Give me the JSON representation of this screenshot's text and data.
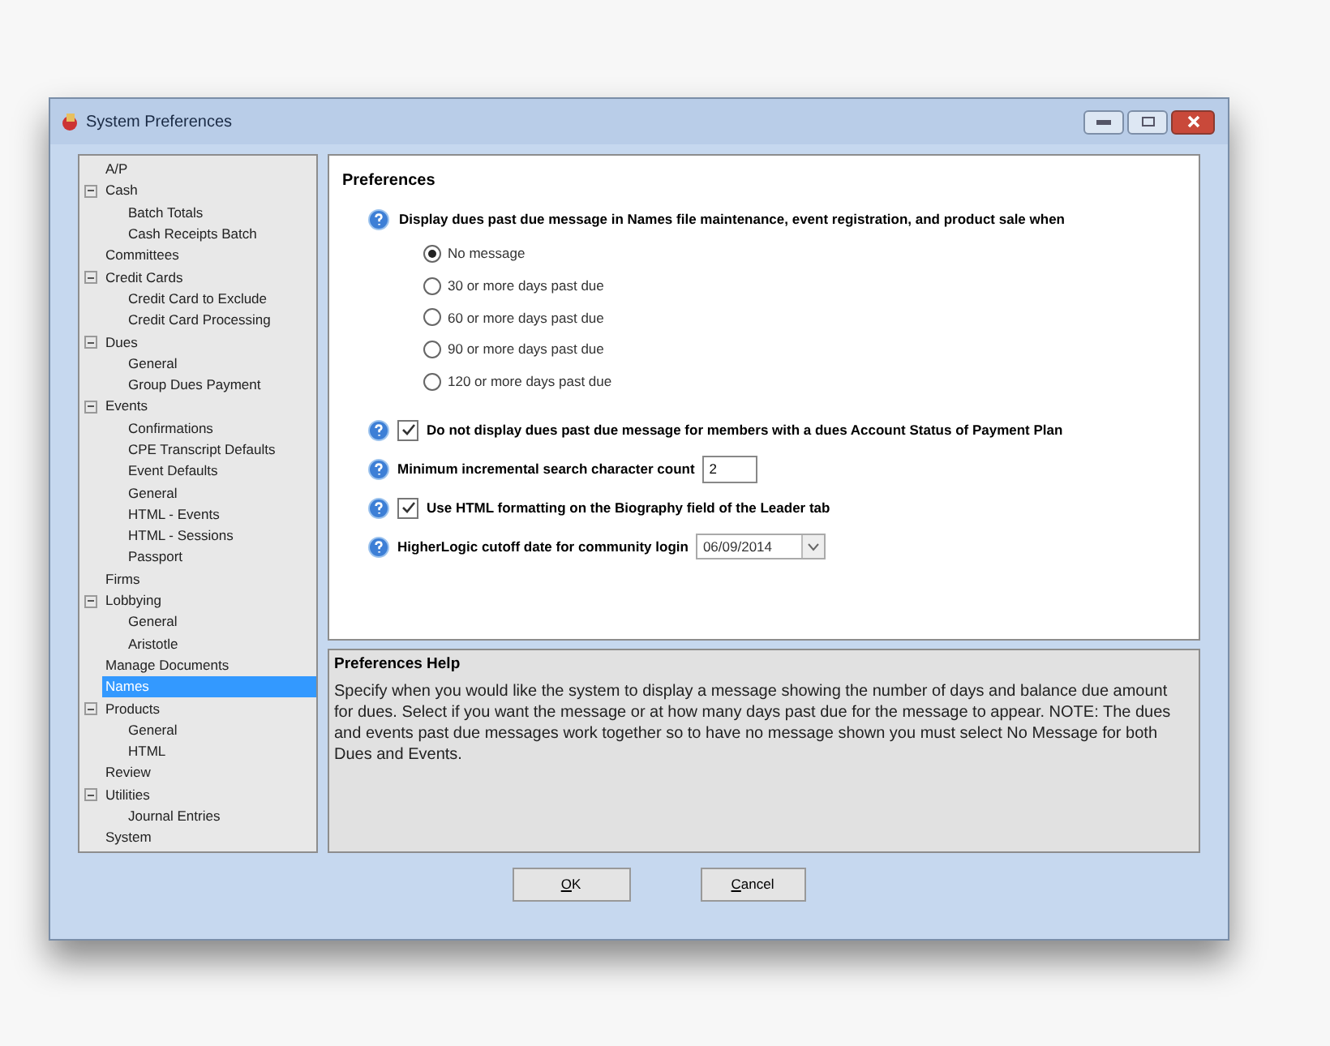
{
  "window": {
    "title": "System Preferences"
  },
  "tree": [
    {
      "label": "A/P",
      "selected": false
    },
    {
      "label": "Cash",
      "selected": false,
      "expanded": true,
      "children": [
        {
          "label": "Batch Totals",
          "selected": false
        },
        {
          "label": "Cash Receipts Batch",
          "selected": false
        }
      ]
    },
    {
      "label": "Committees",
      "selected": false
    },
    {
      "label": "Credit Cards",
      "selected": false,
      "expanded": true,
      "children": [
        {
          "label": "Credit Card to Exclude",
          "selected": false
        },
        {
          "label": "Credit Card Processing",
          "selected": false
        }
      ]
    },
    {
      "label": "Dues",
      "selected": false,
      "expanded": true,
      "children": [
        {
          "label": "General",
          "selected": false
        },
        {
          "label": "Group Dues Payment",
          "selected": false
        }
      ]
    },
    {
      "label": "Events",
      "selected": false,
      "expanded": true,
      "children": [
        {
          "label": "Confirmations",
          "selected": false
        },
        {
          "label": "CPE Transcript Defaults",
          "selected": false
        },
        {
          "label": "Event Defaults",
          "selected": false
        },
        {
          "label": "General",
          "selected": false
        },
        {
          "label": "HTML - Events",
          "selected": false
        },
        {
          "label": "HTML - Sessions",
          "selected": false
        },
        {
          "label": "Passport",
          "selected": false
        }
      ]
    },
    {
      "label": "Firms",
      "selected": false
    },
    {
      "label": "Lobbying",
      "selected": false,
      "expanded": true,
      "children": [
        {
          "label": "General",
          "selected": false
        },
        {
          "label": "Aristotle",
          "selected": false
        }
      ]
    },
    {
      "label": "Manage Documents",
      "selected": false
    },
    {
      "label": "Names",
      "selected": true
    },
    {
      "label": "Products",
      "selected": false,
      "expanded": true,
      "children": [
        {
          "label": "General",
          "selected": false
        },
        {
          "label": "HTML",
          "selected": false
        }
      ]
    },
    {
      "label": "Review",
      "selected": false
    },
    {
      "label": "Utilities",
      "selected": false,
      "expanded": true,
      "children": [
        {
          "label": "Journal Entries",
          "selected": false
        }
      ]
    },
    {
      "label": "System",
      "selected": false
    }
  ],
  "preferences": {
    "title": "Preferences",
    "question": "Display dues past due message in Names file maintenance, event registration, and product sale when",
    "options": [
      {
        "label": "No message",
        "selected": true
      },
      {
        "label": "30 or more days past due",
        "selected": false
      },
      {
        "label": "60 or more days past due",
        "selected": false
      },
      {
        "label": "90 or more days past due",
        "selected": false
      },
      {
        "label": "120 or more days past due",
        "selected": false
      }
    ],
    "settings": [
      {
        "kind": "checkbox",
        "label": "Do not display dues past due message for members with a dues Account Status of Payment Plan",
        "checked": true
      },
      {
        "kind": "number",
        "label": "Minimum incremental search character count",
        "value": "2"
      },
      {
        "kind": "checkbox",
        "label": "Use HTML formatting on the Biography field of the Leader tab",
        "checked": true
      },
      {
        "kind": "date",
        "label": "HigherLogic cutoff date for community login",
        "value": "06/09/2014"
      }
    ]
  },
  "help": {
    "title": "Preferences Help",
    "text": "Specify when you would like the system to display a message showing the number of days and balance due amount for dues. Select if you want the message or at how many days past due for the message to appear. NOTE: The dues and events past due messages work together so to have no message shown you must select No Message for both Dues and Events."
  },
  "buttons": [
    "OK",
    "Cancel"
  ]
}
